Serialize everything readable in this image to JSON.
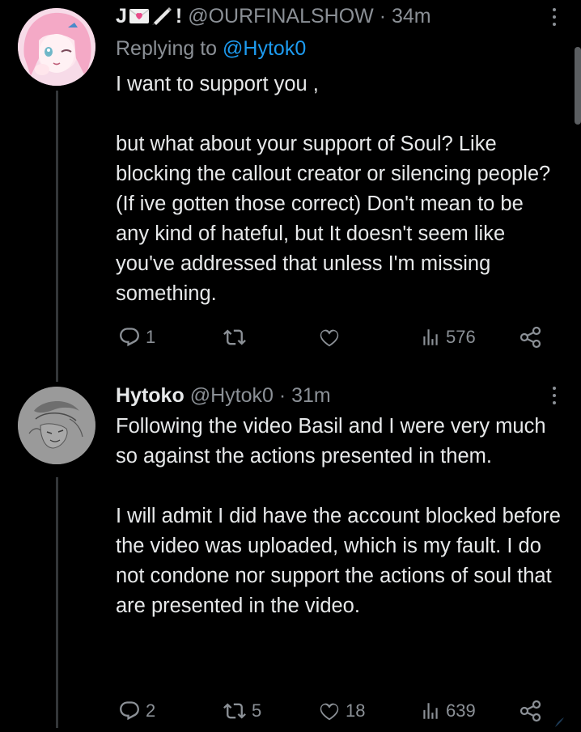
{
  "tweet1": {
    "display_name_prefix": "J",
    "display_name_suffix": "!",
    "handle": "@OURFINALSHOW",
    "separator": "·",
    "time": "34m",
    "replying_prefix": "Replying to ",
    "replying_handle": "@Hytok0",
    "body": "I want to support you ,\n\nbut what about your support of Soul? Like blocking the callout creator or silencing people? (If ive gotten those correct) Don't mean to be any kind of hateful, but It doesn't seem like you've addressed that unless I'm missing something.",
    "actions": {
      "replies": "1",
      "retweets": "",
      "likes": "",
      "views": "576"
    }
  },
  "tweet2": {
    "display_name": "Hytoko",
    "handle": "@Hytok0",
    "separator": "·",
    "time": "31m",
    "body": "Following the video Basil and I were very much so against the actions presented in them.\n\nI will admit I did have the account blocked before the video was uploaded, which is my fault. I do not condone nor support the actions of soul that are presented in the video.",
    "actions": {
      "replies": "2",
      "retweets": "5",
      "likes": "18",
      "views": "639"
    }
  },
  "icons": {
    "reply": "reply-icon",
    "retweet": "retweet-icon",
    "like": "heart-icon",
    "views": "views-chart-icon",
    "share": "share-icon",
    "more": "more-vertical-icon",
    "envelope_emoji": "love-letter-emoji",
    "pen_emoji": "pen-emoji"
  },
  "colors": {
    "background": "#000000",
    "text": "#e7e9ea",
    "secondary": "#8b9096",
    "link": "#1d9bf0",
    "thread_line": "#333639"
  }
}
